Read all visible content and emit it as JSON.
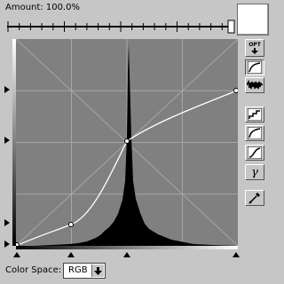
{
  "amount": {
    "label": "Amount: 100.0%",
    "value_percent": 100.0
  },
  "preview_swatch_color": "#ffffff",
  "color_space": {
    "label": "Color Space:",
    "selected": "RGB"
  },
  "tools": [
    {
      "name": "opt-button",
      "label": "OPT"
    },
    {
      "name": "curve-mode-button"
    },
    {
      "name": "noise-mode-button"
    },
    {
      "name": "steps-preset-button"
    },
    {
      "name": "curve-preset-button"
    },
    {
      "name": "s-curve-preset-button"
    },
    {
      "name": "gamma-button",
      "label": "γ"
    },
    {
      "name": "eyedropper-button"
    }
  ],
  "colors": {
    "panel": "#c6c6c6",
    "graph": "#808080",
    "histogram": "#000000",
    "curve": "#ffffff"
  }
}
